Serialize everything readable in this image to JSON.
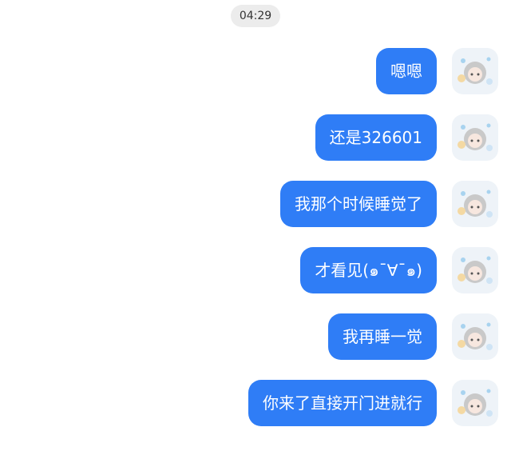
{
  "timestamp": "04:29",
  "messages": [
    {
      "text": "嗯嗯"
    },
    {
      "text": "还是326601"
    },
    {
      "text": "我那个时候睡觉了"
    },
    {
      "text": "才看见(๑¯∀¯๑)"
    },
    {
      "text": "我再睡一觉"
    },
    {
      "text": "你来了直接开门进就行"
    }
  ],
  "colors": {
    "bubble": "#2f7df6",
    "bubble_text": "#ffffff",
    "timestamp_bg": "#ececec"
  },
  "avatar_icon": "cartoon-girl-avatar-icon"
}
